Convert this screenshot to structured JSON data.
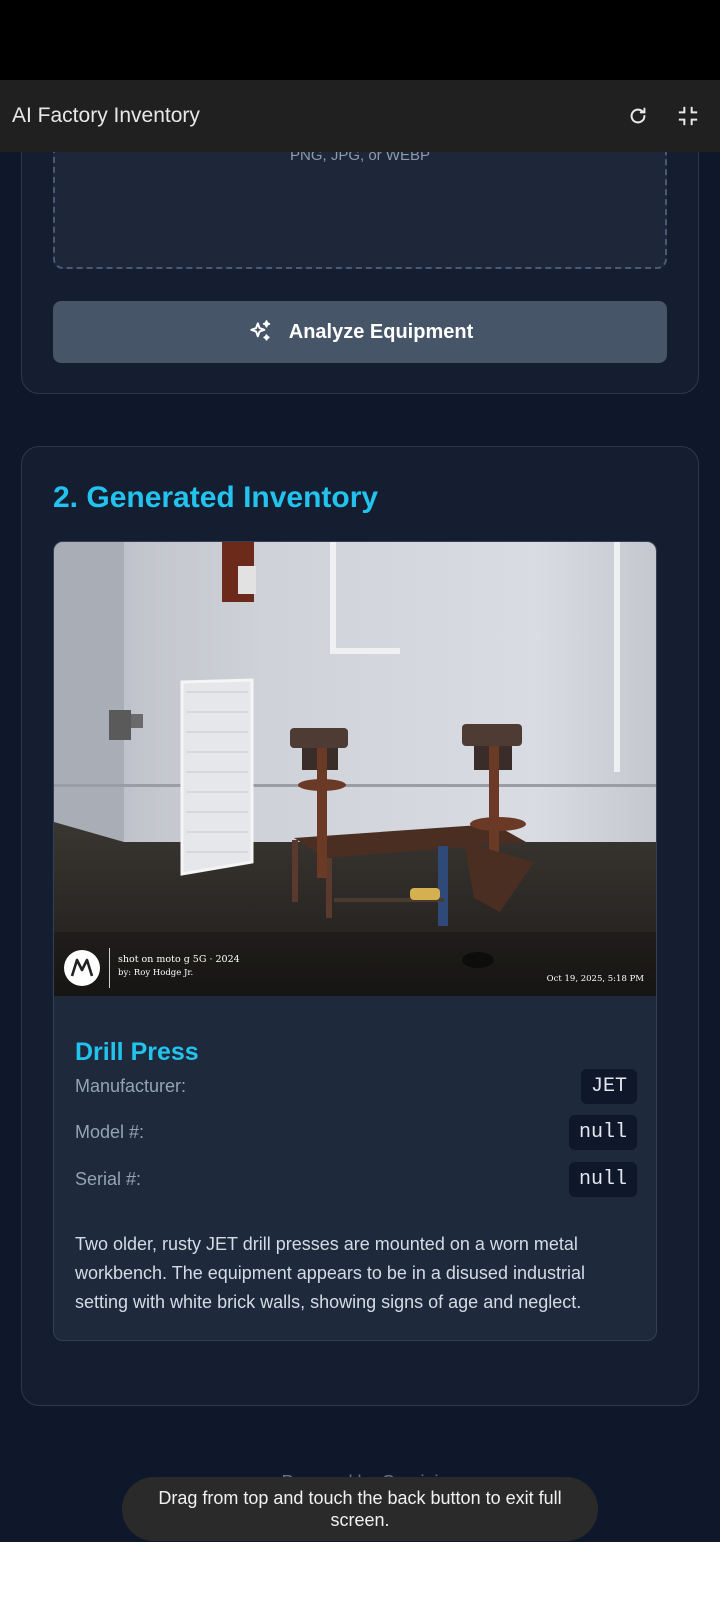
{
  "app_bar": {
    "title": "AI Factory Inventory",
    "icons": [
      "refresh-icon",
      "exit-fullscreen-icon"
    ]
  },
  "upload": {
    "hint": "PNG, JPG, or WEBP",
    "analyze_label": "Analyze Equipment"
  },
  "inventory": {
    "section_title": "2. Generated Inventory",
    "photo": {
      "watermark_line1": "shot on moto g 5G · 2024",
      "watermark_line2": "by: Roy Hodge Jr.",
      "watermark_date": "Oct 19, 2025, 5:18 PM"
    },
    "item": {
      "name": "Drill Press",
      "fields": [
        {
          "label": "Manufacturer:",
          "value": "JET"
        },
        {
          "label": "Model #:",
          "value": "null"
        },
        {
          "label": "Serial #:",
          "value": "null"
        }
      ],
      "description": "Two older, rusty JET drill presses are mounted on a worn metal workbench. The equipment appears to be in a disused industrial setting with white brick walls, showing signs of age and neglect."
    }
  },
  "footer": {
    "text": "Powered by Gemini"
  },
  "toast": {
    "message": "Drag from top and touch the back button to exit full screen."
  },
  "colors": {
    "accent": "#22c3ee",
    "background": "#0f172a",
    "card": "#151e31",
    "button": "#475569"
  }
}
